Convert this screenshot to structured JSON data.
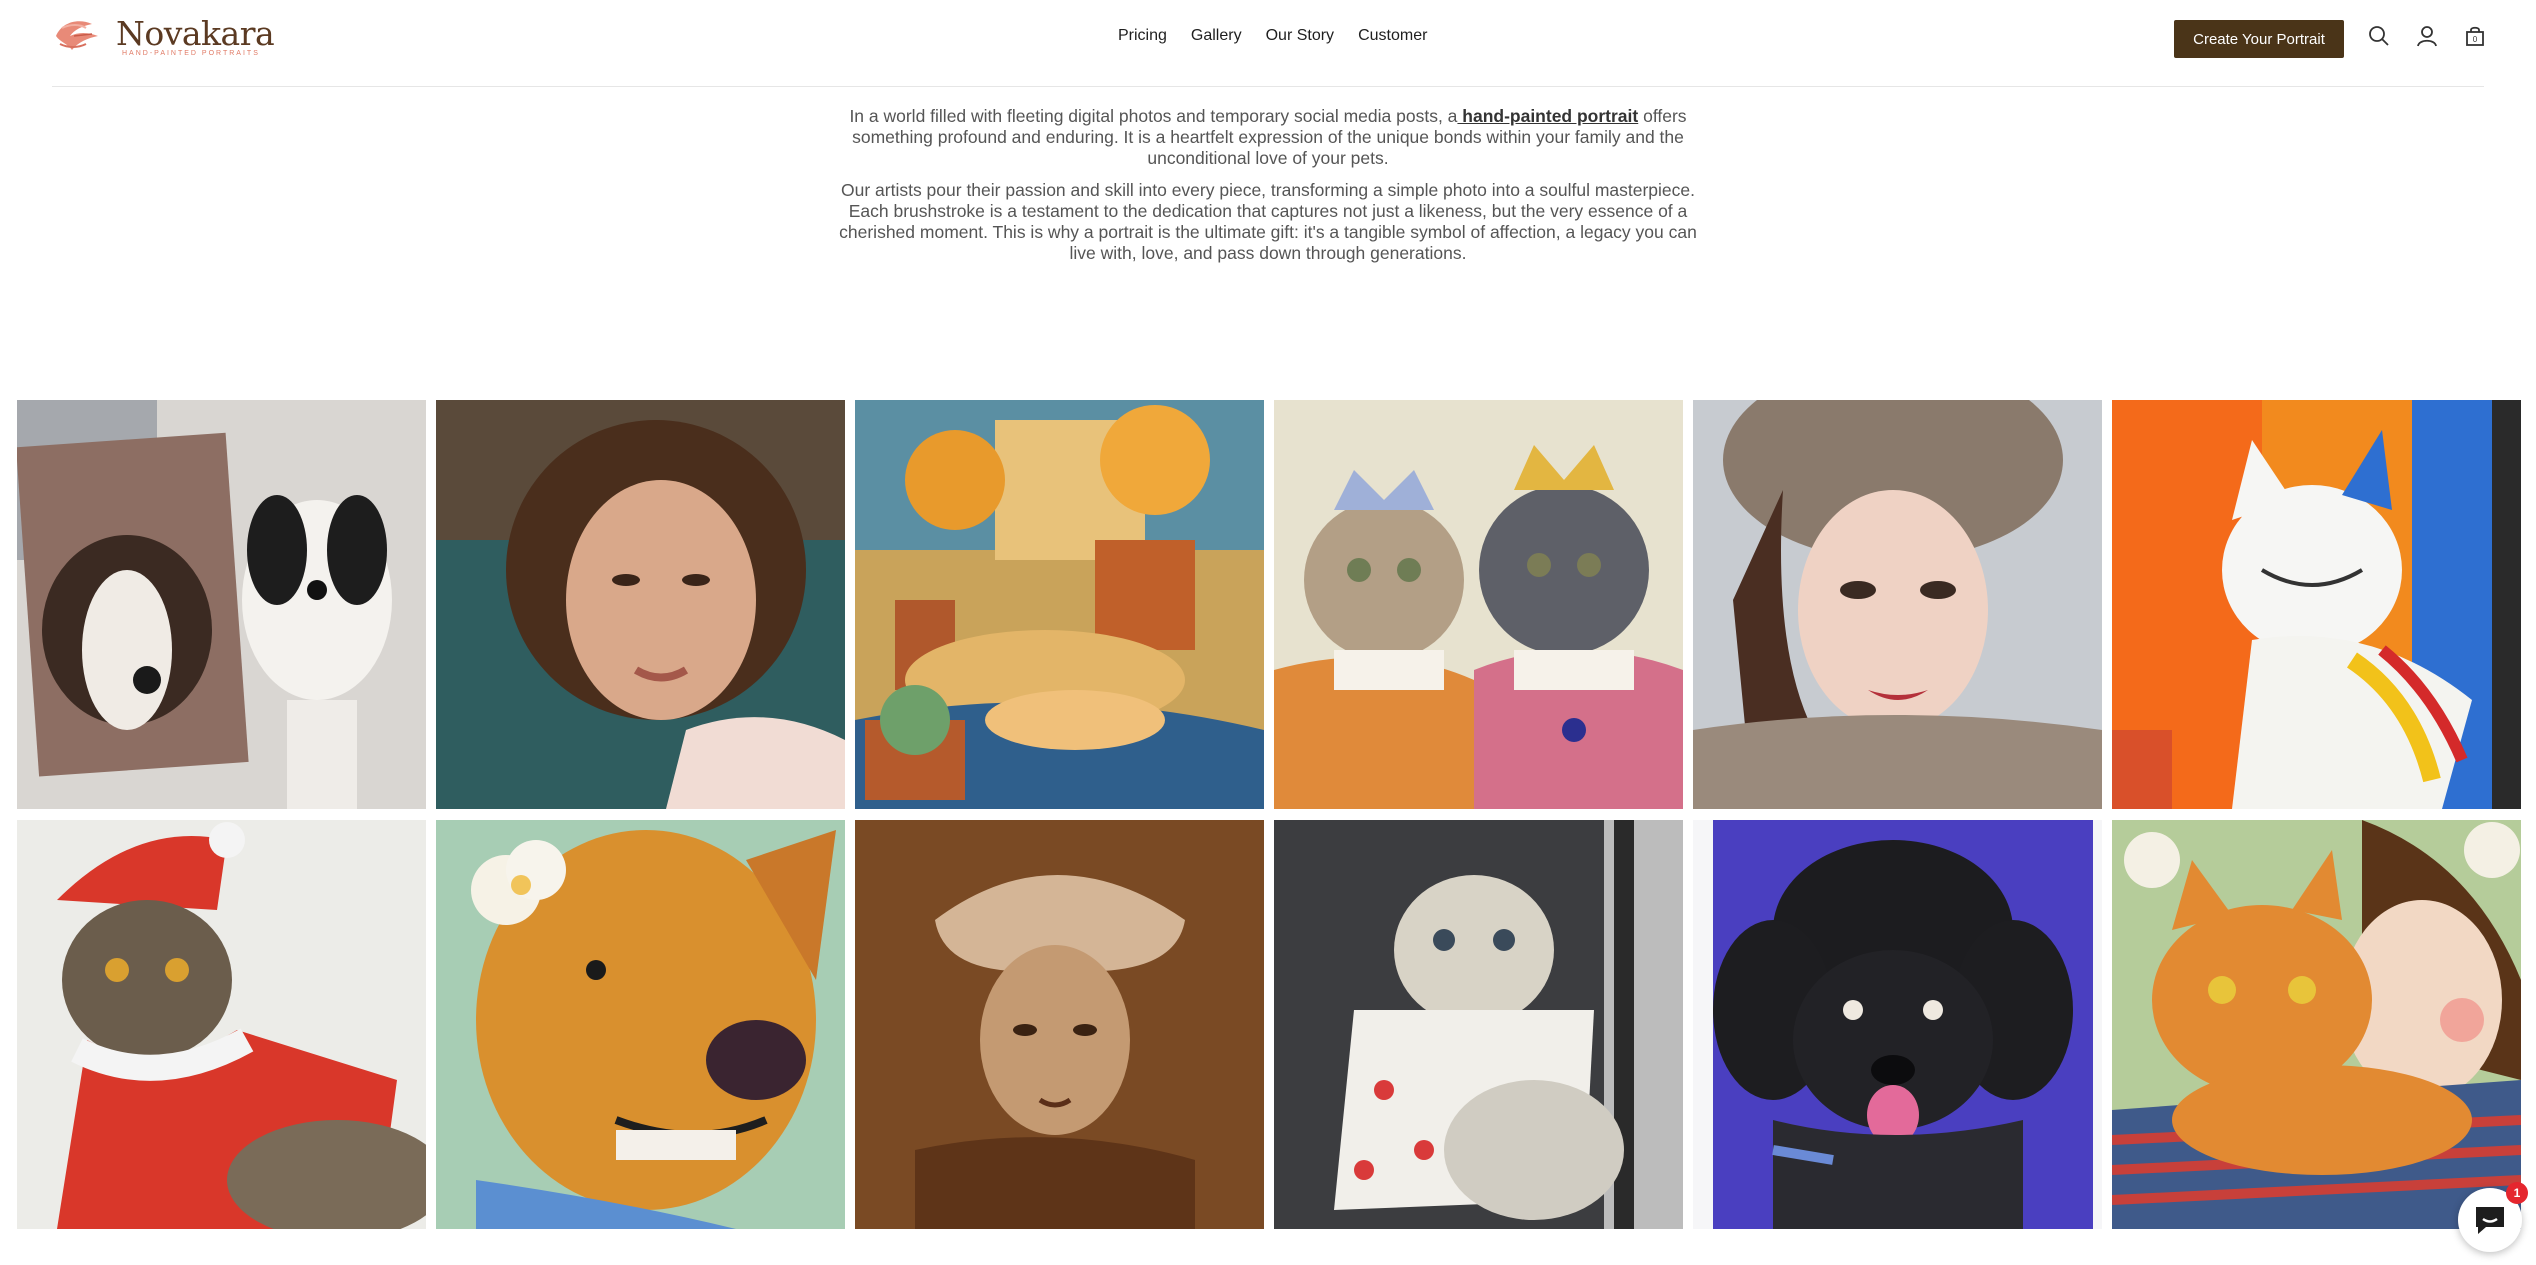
{
  "brand": {
    "name": "Novakara",
    "tagline": "HAND-PAINTED PORTRAITS"
  },
  "nav": {
    "items": [
      "Pricing",
      "Gallery",
      "Our Story",
      "Customer"
    ]
  },
  "header": {
    "cta_label": "Create Your Portrait",
    "icons": [
      "search-icon",
      "account-icon",
      "cart-icon"
    ]
  },
  "intro": {
    "p1_before": "In a world filled with fleeting digital photos and temporary social media posts, a",
    "p1_link": " hand-painted portrait",
    "p1_after": " offers something profound and enduring. It is a heartfelt expression of the unique bonds within your family and the unconditional love of your pets.",
    "p2": "Our artists pour their passion and skill into every piece, transforming a simple photo into a soulful masterpiece. Each brushstroke is a testament to the dedication that captures not just a likeness, but the very essence of a cherished moment. This is why a portrait is the ultimate gift: it's a tangible symbol of affection, a legacy you can live with, love, and pass down through generations."
  },
  "gallery": {
    "images": [
      {
        "subject": "dog-portrait-with-dog"
      },
      {
        "subject": "woman-oil-portrait"
      },
      {
        "subject": "golden-retriever-puppies-still-life"
      },
      {
        "subject": "royal-cats-portrait"
      },
      {
        "subject": "woman-fur-hat-portrait"
      },
      {
        "subject": "colorful-cat-painting"
      },
      {
        "subject": "cat-santa-costume"
      },
      {
        "subject": "dog-with-flower"
      },
      {
        "subject": "sepia-woman-bonnet"
      },
      {
        "subject": "cat-dress-portrait"
      },
      {
        "subject": "black-poodle-painting"
      },
      {
        "subject": "girl-with-orange-cat"
      }
    ]
  },
  "chat": {
    "badge": "1",
    "icon": "chat-icon"
  },
  "colors": {
    "cta_bg": "#4a3418",
    "brand_text": "#5b3a22",
    "brand_accent": "#e07a65",
    "badge": "#e5262e"
  }
}
